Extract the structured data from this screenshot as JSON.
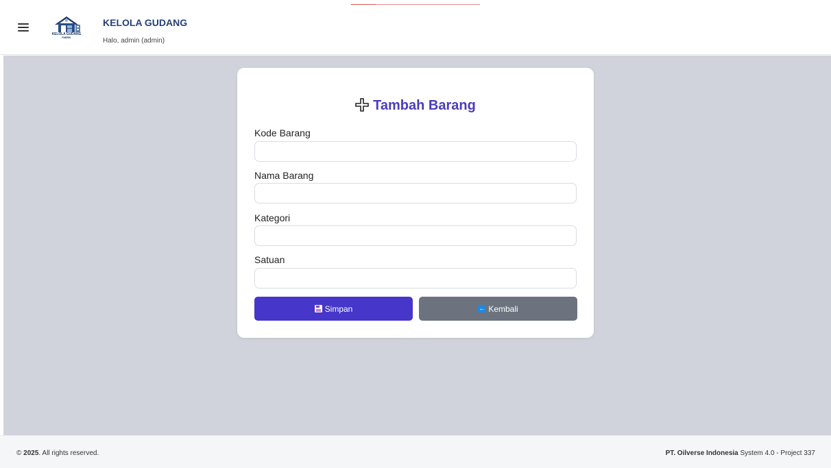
{
  "header": {
    "brand_title": "KELOLA GUDANG",
    "greeting": "Halo, admin (admin)",
    "logo": {
      "text": "KELOLA GUDANG",
      "subtext": "PABRIK"
    }
  },
  "form": {
    "title": "Tambah Barang",
    "fields": [
      {
        "label": "Kode Barang",
        "value": ""
      },
      {
        "label": "Nama Barang",
        "value": ""
      },
      {
        "label": "Kategori",
        "value": ""
      },
      {
        "label": "Satuan",
        "value": ""
      }
    ],
    "save_label": "Simpan",
    "back_label": "Kembali"
  },
  "footer": {
    "year": "2025",
    "rights": ". All rights reserved.",
    "company": "PT. Oilverse Indonesia",
    "system": " System 4.0 - Project 337"
  },
  "colors": {
    "accent": "#4636c9",
    "title": "#4a3cc0",
    "brand": "#27407a",
    "secondary_button": "#6c737e",
    "background": "#d0d3dc"
  },
  "icons": [
    "menu-icon",
    "plus-icon",
    "save-icon",
    "back-arrow-icon"
  ]
}
